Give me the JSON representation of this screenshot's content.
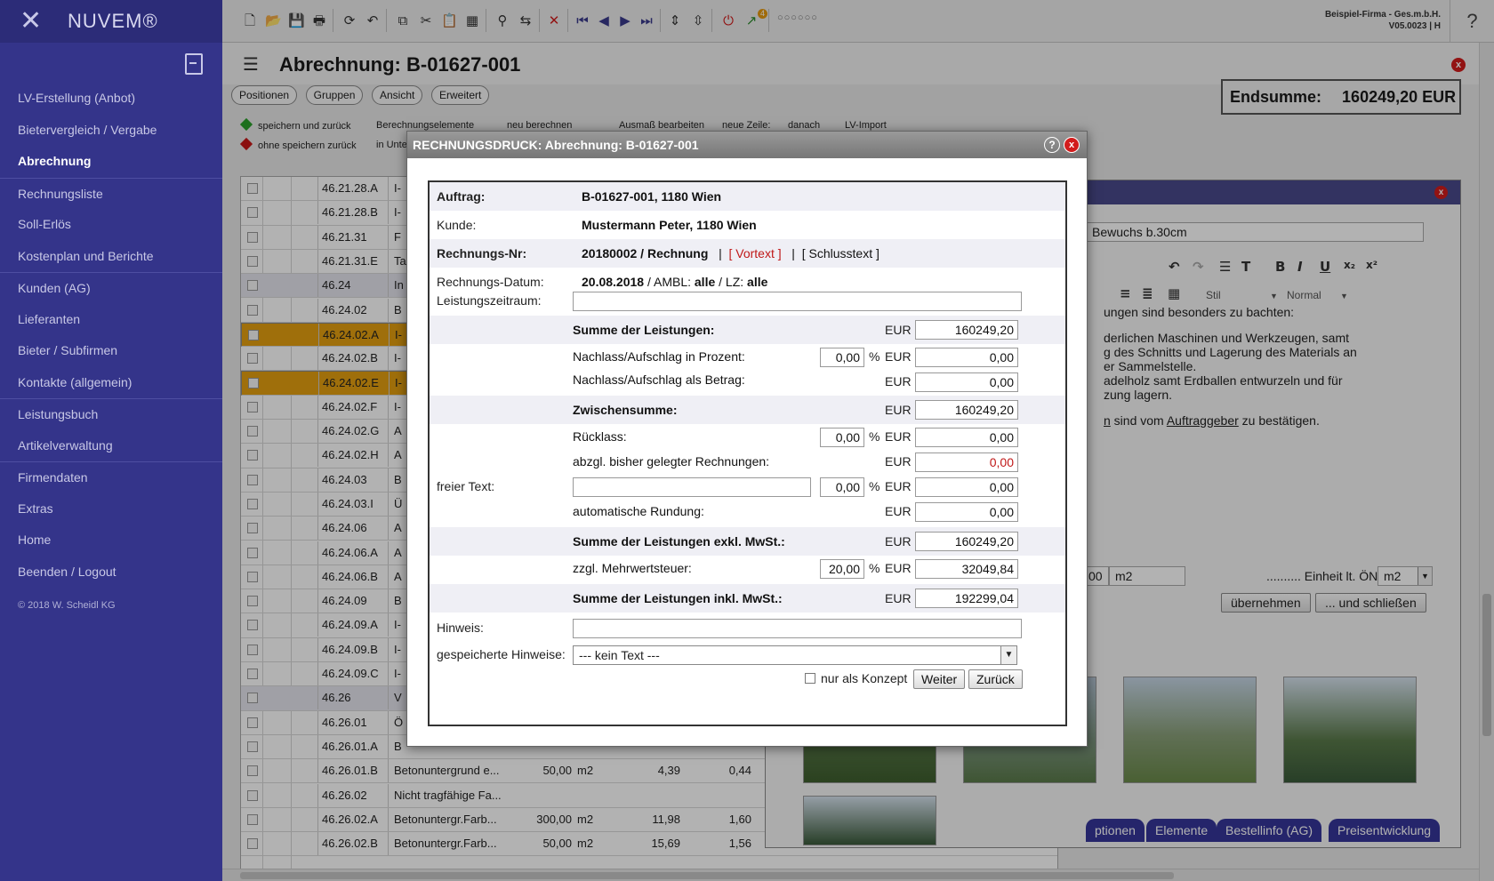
{
  "sidebar": {
    "brand": "NUVEM®",
    "items": [
      {
        "label": "LV-Erstellung (Anbot)"
      },
      {
        "label": "Bietervergleich / Vergabe"
      },
      {
        "label": "Abrechnung",
        "active": true
      },
      {
        "label": "Rechnungsliste"
      },
      {
        "label": "Soll-Erlös"
      },
      {
        "label": "Kostenplan und Berichte"
      },
      {
        "label": "Kunden (AG)"
      },
      {
        "label": "Lieferanten"
      },
      {
        "label": "Bieter / Subfirmen"
      },
      {
        "label": "Kontakte (allgemein)"
      },
      {
        "label": "Leistungsbuch"
      },
      {
        "label": "Artikelverwaltung"
      },
      {
        "label": "Firmendaten"
      },
      {
        "label": "Extras"
      },
      {
        "label": "Home"
      },
      {
        "label": "Beenden / Logout"
      }
    ],
    "copyright": "© 2018 W. Scheidl KG"
  },
  "toolbar": {
    "company": "Beispiel-Firma - Ges.m.b.H.",
    "version": "V05.0023 | H",
    "help": "?",
    "badge": "4",
    "dots": "○○○○○○"
  },
  "header": {
    "title": "Abrechnung: B-01627-001",
    "tabs": [
      "Positionen",
      "Gruppen",
      "Ansicht",
      "Erweitert"
    ],
    "endsumme_label": "Endsumme:",
    "endsumme_value": "160249,20 EUR",
    "ribbon": {
      "save_back": "speichern und zurück",
      "nosave_back": "ohne speichern zurück",
      "berech": "Berechnungselemente",
      "inunte": "in Unte",
      "neu": "neu berechnen",
      "ausmass": "Ausmaß bearbeiten",
      "neuezeile": "neue Zeile:",
      "danach": "danach",
      "lvimport": "LV-Import"
    }
  },
  "table": {
    "rows": [
      {
        "pos": "46.21.28.A",
        "txt": "I-",
        "qty": "",
        "unit": "",
        "ep": "",
        "gp": "",
        "state": ""
      },
      {
        "pos": "46.21.28.B",
        "txt": "I-",
        "qty": "",
        "unit": "",
        "ep": "",
        "gp": "",
        "state": ""
      },
      {
        "pos": "46.21.31",
        "txt": "F",
        "qty": "",
        "unit": "",
        "ep": "",
        "gp": "",
        "state": ""
      },
      {
        "pos": "46.21.31.E",
        "txt": "Ta",
        "qty": "",
        "unit": "",
        "ep": "",
        "gp": "",
        "state": ""
      },
      {
        "pos": "46.24",
        "txt": "In",
        "qty": "",
        "unit": "",
        "ep": "",
        "gp": "",
        "state": "grp"
      },
      {
        "pos": "46.24.02",
        "txt": "B",
        "qty": "",
        "unit": "",
        "ep": "",
        "gp": "",
        "state": ""
      },
      {
        "pos": "46.24.02.A",
        "txt": "I-",
        "qty": "",
        "unit": "",
        "ep": "",
        "gp": "",
        "state": "sel"
      },
      {
        "pos": "46.24.02.B",
        "txt": "I-",
        "qty": "",
        "unit": "",
        "ep": "",
        "gp": "",
        "state": ""
      },
      {
        "pos": "46.24.02.E",
        "txt": "I-",
        "qty": "",
        "unit": "",
        "ep": "",
        "gp": "",
        "state": "sel"
      },
      {
        "pos": "46.24.02.F",
        "txt": "I-",
        "qty": "",
        "unit": "",
        "ep": "",
        "gp": "",
        "state": ""
      },
      {
        "pos": "46.24.02.G",
        "txt": "A",
        "qty": "",
        "unit": "",
        "ep": "",
        "gp": "",
        "state": ""
      },
      {
        "pos": "46.24.02.H",
        "txt": "A",
        "qty": "",
        "unit": "",
        "ep": "",
        "gp": "",
        "state": ""
      },
      {
        "pos": "46.24.03",
        "txt": "B",
        "qty": "",
        "unit": "",
        "ep": "",
        "gp": "",
        "state": ""
      },
      {
        "pos": "46.24.03.I",
        "txt": "Ü",
        "qty": "",
        "unit": "",
        "ep": "",
        "gp": "",
        "state": ""
      },
      {
        "pos": "46.24.06",
        "txt": "A",
        "qty": "",
        "unit": "",
        "ep": "",
        "gp": "",
        "state": ""
      },
      {
        "pos": "46.24.06.A",
        "txt": "A",
        "qty": "",
        "unit": "",
        "ep": "",
        "gp": "",
        "state": ""
      },
      {
        "pos": "46.24.06.B",
        "txt": "A",
        "qty": "",
        "unit": "",
        "ep": "",
        "gp": "",
        "state": ""
      },
      {
        "pos": "46.24.09",
        "txt": "B",
        "qty": "",
        "unit": "",
        "ep": "",
        "gp": "",
        "state": ""
      },
      {
        "pos": "46.24.09.A",
        "txt": "I-",
        "qty": "",
        "unit": "",
        "ep": "",
        "gp": "",
        "state": ""
      },
      {
        "pos": "46.24.09.B",
        "txt": "I-",
        "qty": "",
        "unit": "",
        "ep": "",
        "gp": "",
        "state": ""
      },
      {
        "pos": "46.24.09.C",
        "txt": "I-",
        "qty": "",
        "unit": "",
        "ep": "",
        "gp": "",
        "state": ""
      },
      {
        "pos": "46.26",
        "txt": "V",
        "qty": "",
        "unit": "",
        "ep": "",
        "gp": "",
        "state": "grp"
      },
      {
        "pos": "46.26.01",
        "txt": "Ö",
        "qty": "",
        "unit": "",
        "ep": "",
        "gp": "",
        "state": ""
      },
      {
        "pos": "46.26.01.A",
        "txt": "B",
        "qty": "",
        "unit": "",
        "ep": "",
        "gp": "",
        "state": ""
      },
      {
        "pos": "46.26.01.B",
        "txt": "Betonuntergrund e...",
        "qty": "50,00",
        "unit": "m2",
        "ep": "4,39",
        "gp": "0,44",
        "state": ""
      },
      {
        "pos": "46.26.02",
        "txt": "Nicht tragfähige Fa...",
        "qty": "",
        "unit": "",
        "ep": "",
        "gp": "",
        "state": ""
      },
      {
        "pos": "46.26.02.A",
        "txt": "Betonuntergr.Farb...",
        "qty": "300,00",
        "unit": "m2",
        "ep": "11,98",
        "gp": "1,60",
        "state": ""
      },
      {
        "pos": "46.26.02.B",
        "txt": "Betonuntergr.Farb...",
        "qty": "50,00",
        "unit": "m2",
        "ep": "15,69",
        "gp": "1,56",
        "state": ""
      }
    ]
  },
  "editor": {
    "field_text": "Bewuchs b.30cm",
    "style_label": "Stil",
    "format_label": "Normal",
    "lines": [
      "ungen sind besonders zu bachten:",
      "derlichen Maschinen und Werkzeugen, samt",
      "g des Schnitts und Lagerung des Materials an",
      "er Sammelstelle.",
      "adelholz samt Erdballen entwurzeln und für",
      "zung lagern."
    ],
    "line7_a": "n",
    "line7_b": " sind vom ",
    "line7_link": "Auftraggeber",
    "line7_c": " zu bestätigen.",
    "qty_field": "00",
    "unit_field": "m2",
    "einheit_label": ".......... Einheit lt. ÖNorm:",
    "einheit_value": "m2",
    "btn_uebernehmen": "übernehmen",
    "btn_schliessen": "... und schließen",
    "tabs": [
      "ptionen",
      "Elemente",
      "Bestellinfo (AG)",
      "Preisentwicklung"
    ]
  },
  "modal": {
    "title": "RECHNUNGSDRUCK: Abrechnung: B-01627-001",
    "auftrag_label": "Auftrag:",
    "auftrag_value": "B-01627-001, 1180 Wien",
    "kunde_label": "Kunde:",
    "kunde_value": "Mustermann Peter, 1180 Wien",
    "rnr_label": "Rechnungs-Nr:",
    "rnr_value": "20180002 / Rechnung",
    "vortext": "[ Vortext ]",
    "schlusstext": "[ Schlusstext ]",
    "rdatum_label": "Rechnungs-Datum:",
    "rdatum_value": "20.08.2018",
    "ambl_label": "/ AMBL:",
    "ambl_value": "alle",
    "lz_label": "/ LZ:",
    "lz_value": "alle",
    "lz_zeitraum_label": "Leistungszeitraum:",
    "lz_zeitraum_value": "",
    "currency": "EUR",
    "percent": "%",
    "summe_label": "Summe der Leistungen:",
    "summe_value": "160249,20",
    "nachlass_pct_label": "Nachlass/Aufschlag in Prozent:",
    "nachlass_pct_value": "0,00",
    "nachlass_pct_amount": "0,00",
    "nachlass_betrag_label": "Nachlass/Aufschlag als Betrag:",
    "nachlass_betrag_amount": "0,00",
    "zwischensumme_label": "Zwischensumme:",
    "zwischensumme_value": "160249,20",
    "ruecklass_label": "Rücklass:",
    "ruecklass_pct": "0,00",
    "ruecklass_amount": "0,00",
    "abzgl_label": "abzgl. bisher gelegter Rechnungen:",
    "abzgl_amount": "0,00",
    "freier_label": "freier Text:",
    "freier_text": "",
    "freier_pct": "0,00",
    "freier_amount": "0,00",
    "rundung_label": "automatische Rundung:",
    "rundung_amount": "0,00",
    "exkl_label": "Summe der Leistungen exkl. MwSt.:",
    "exkl_value": "160249,20",
    "mwst_label": "zzgl. Mehrwertsteuer:",
    "mwst_pct": "20,00",
    "mwst_amount": "32049,84",
    "inkl_label": "Summe der Leistungen inkl. MwSt.:",
    "inkl_value": "192299,04",
    "hinweis_label": "Hinweis:",
    "hinweis_value": "",
    "gespeichert_label": "gespeicherte Hinweise:",
    "gespeichert_value": "--- kein Text ---",
    "konzept_label": "nur als Konzept",
    "weiter": "Weiter",
    "zurueck": "Zurück"
  }
}
